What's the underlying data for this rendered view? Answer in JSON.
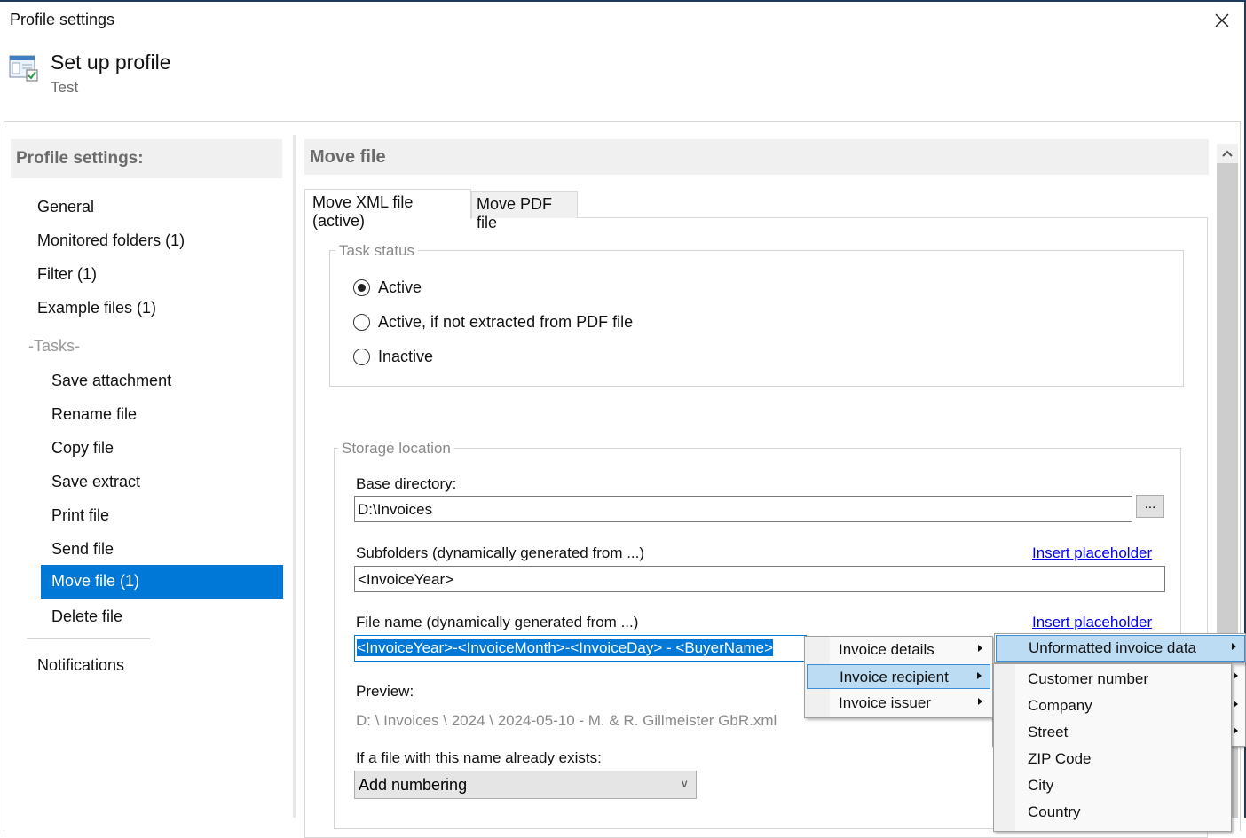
{
  "window": {
    "title": "Profile settings",
    "close_icon": "close-icon"
  },
  "header": {
    "icon": "profile-settings-icon",
    "title": "Set up profile",
    "subtitle": "Test"
  },
  "sidebar": {
    "header": "Profile settings:",
    "items": [
      {
        "label": "General"
      },
      {
        "label": "Monitored folders (1)"
      },
      {
        "label": "Filter (1)"
      },
      {
        "label": "Example files (1)"
      }
    ],
    "tasks_label": "-Tasks-",
    "tasks": [
      {
        "label": "Save attachment"
      },
      {
        "label": "Rename file"
      },
      {
        "label": "Copy file"
      },
      {
        "label": "Save extract"
      },
      {
        "label": "Print file"
      },
      {
        "label": "Send file"
      },
      {
        "label": "Move file (1)",
        "selected": true
      },
      {
        "label": "Delete file"
      }
    ],
    "notifications": "Notifications",
    "selected_color": "#0078d7"
  },
  "main": {
    "title": "Move file",
    "tabs": [
      {
        "label": "Move XML file (active)",
        "active": true
      },
      {
        "label": "Move PDF file",
        "active": false
      }
    ],
    "task_status": {
      "legend": "Task status",
      "options": [
        {
          "label": "Active",
          "checked": true
        },
        {
          "label": "Active, if not extracted from PDF file",
          "checked": false
        },
        {
          "label": "Inactive",
          "checked": false
        }
      ]
    },
    "storage": {
      "legend": "Storage location",
      "base_dir_label": "Base directory:",
      "base_dir_value": "D:\\Invoices",
      "browse_label": "...",
      "subfolders_label": "Subfolders (dynamically generated from ...)",
      "subfolders_value": "<InvoiceYear>",
      "insert_placeholder": "Insert placeholder",
      "filename_label": "File name (dynamically generated from ...)",
      "filename_value": "<InvoiceYear>-<InvoiceMonth>-<InvoiceDay> - <BuyerName>",
      "preview_label": "Preview:",
      "preview_value": "D: \\ Invoices \\ 2024 \\ 2024-05-10 - M. & R. Gillmeister GbR.xml",
      "exists_label": "If a file with this name already exists:",
      "exists_value": "Add numbering"
    }
  },
  "context_menu": {
    "items": [
      {
        "label": "Invoice details",
        "submenu": true
      },
      {
        "label": "Invoice recipient",
        "submenu": true,
        "highlighted": true
      },
      {
        "label": "Invoice issuer",
        "submenu": true
      }
    ],
    "submenu_header": {
      "label": "Unformatted invoice data",
      "submenu": true,
      "highlighted": true
    },
    "submenu_items": [
      {
        "label": "Customer number"
      },
      {
        "label": "Company"
      },
      {
        "label": "Street"
      },
      {
        "label": "ZIP Code"
      },
      {
        "label": "City"
      },
      {
        "label": "Country"
      }
    ],
    "highlight_color": "#bcdcf4"
  }
}
